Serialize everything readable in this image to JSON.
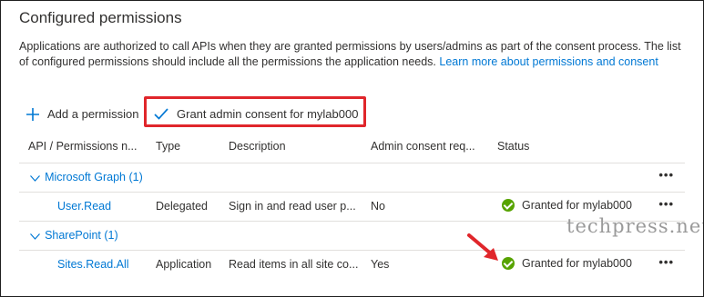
{
  "title": "Configured permissions",
  "description": {
    "text": "Applications are authorized to call APIs when they are granted permissions by users/admins as part of the consent process. The list of configured permissions should include all the permissions the application needs. ",
    "link": "Learn more about permissions and consent"
  },
  "toolbar": {
    "add_label": "Add a permission",
    "grant_label": "Grant admin consent for mylab000"
  },
  "table": {
    "headers": [
      "API / Permissions n...",
      "Type",
      "Description",
      "Admin consent req...",
      "Status"
    ],
    "groups": [
      {
        "name": "Microsoft Graph (1)",
        "rows": [
          {
            "api": "User.Read",
            "type": "Delegated",
            "description": "Sign in and read user p...",
            "admin_consent": "No",
            "status": "Granted for mylab000"
          }
        ]
      },
      {
        "name": "SharePoint (1)",
        "rows": [
          {
            "api": "Sites.Read.All",
            "type": "Application",
            "description": "Read items in all site co...",
            "admin_consent": "Yes",
            "status": "Granted for mylab000"
          }
        ]
      }
    ],
    "more": "•••"
  },
  "watermark": "techpress.net",
  "colors": {
    "link": "#0078d4",
    "granted": "#57a300",
    "highlight": "#e0262b"
  },
  "icons": {
    "add": "plus-icon",
    "grant": "checkmark-icon",
    "expand": "chevron-down-icon",
    "granted": "check-circle-icon",
    "more": "more-icon"
  }
}
